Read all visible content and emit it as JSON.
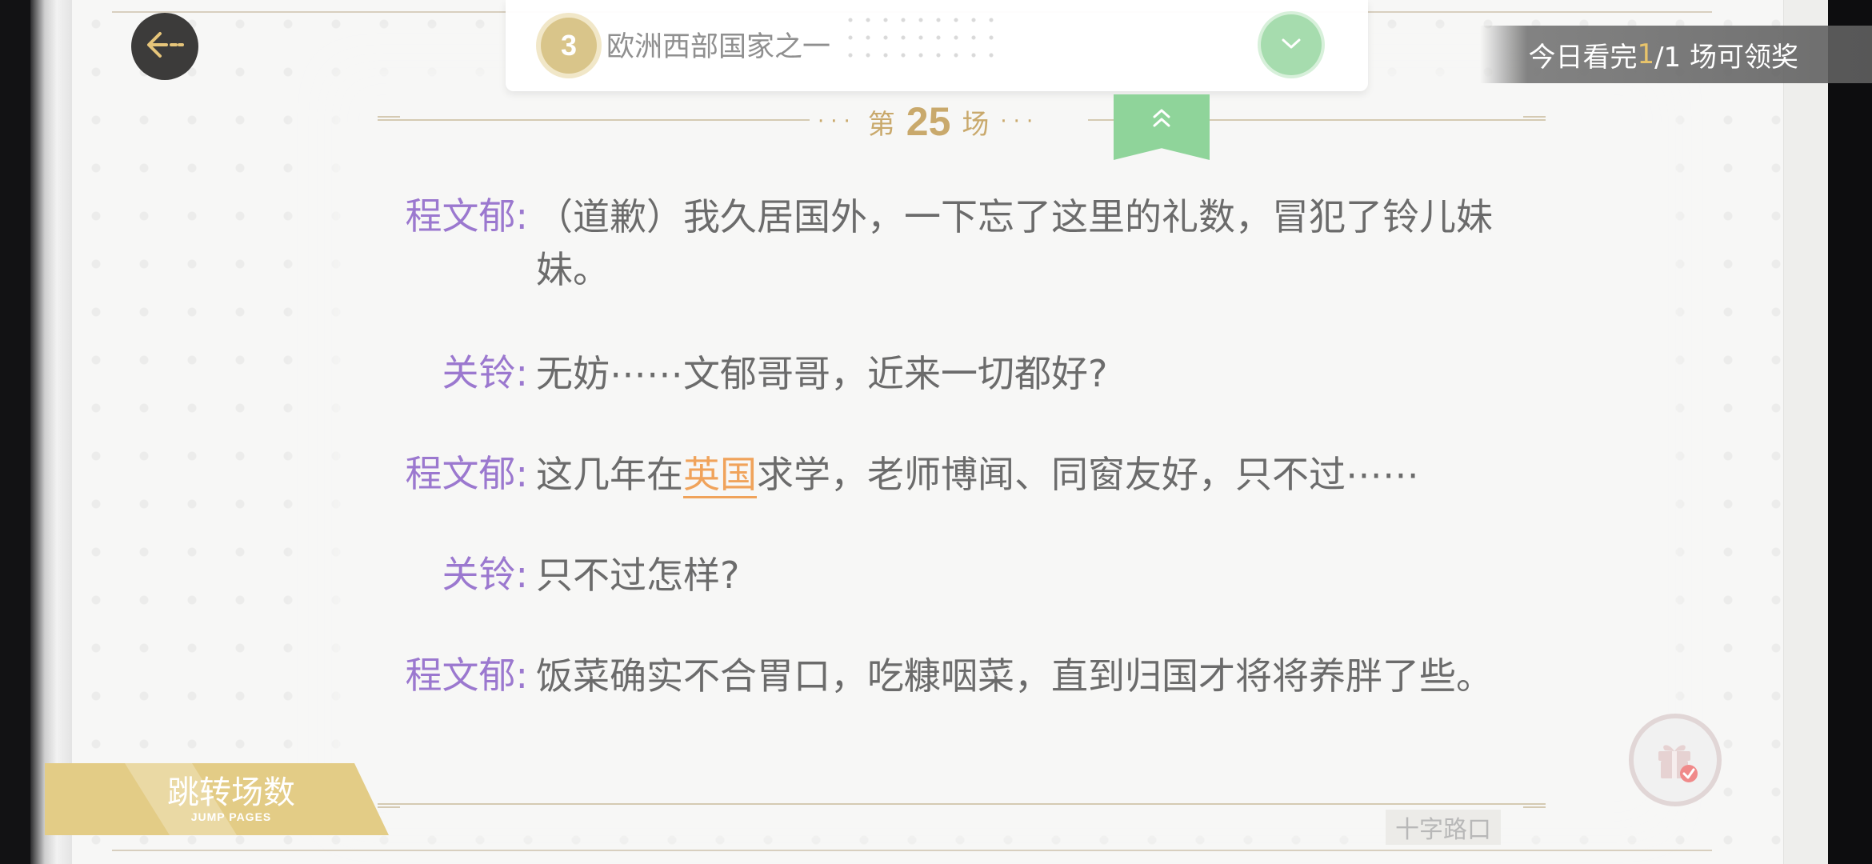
{
  "question": {
    "number": "3",
    "text": "欧洲西部国家之一"
  },
  "reward": {
    "prefix": "今日看完 ",
    "current": "1",
    "suffix": "/1 场可领奖"
  },
  "scene": {
    "dots_left": "···",
    "prefix": "第",
    "number": "25",
    "suffix": "场",
    "dots_right": "···"
  },
  "dialogue": [
    {
      "speaker": "程文郁:",
      "text": "（道歉）我久居国外，一下忘了这里的礼数，冒犯了铃儿妹妹。"
    },
    {
      "speaker": "关铃:",
      "text": "无妨⋯⋯文郁哥哥，近来一切都好?"
    },
    {
      "speaker": "程文郁:",
      "text_before": "这几年在",
      "keyword": "英国",
      "text_after": "求学，老师博闻、同窗友好，只不过⋯⋯"
    },
    {
      "speaker": "关铃:",
      "text": "只不过怎样?"
    },
    {
      "speaker": "程文郁:",
      "text": "饭菜确实不合胃口，吃糠咽菜，直到归国才将将养胖了些。"
    }
  ],
  "location": "十字路口",
  "jump": {
    "label": "跳转场数",
    "sub_label": "JUMP PAGES"
  },
  "colors": {
    "speaker": "#9b78cf",
    "speech": "#6b6b6b",
    "keyword": "#f0a35b",
    "gold": "#c9a96c",
    "green": "#8fd49a"
  },
  "icons": [
    "back-arrow-icon",
    "chevron-down-icon",
    "double-chevron-up-icon",
    "gift-icon",
    "checkmark-icon"
  ]
}
